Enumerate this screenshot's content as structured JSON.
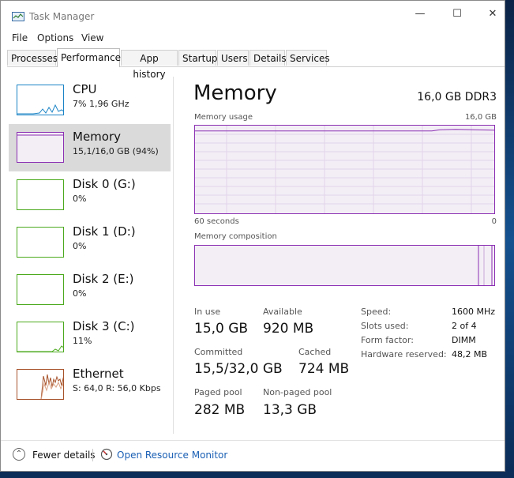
{
  "window": {
    "title": "Task Manager"
  },
  "controls": {
    "minimize": "—",
    "maximize": "☐",
    "close": "✕"
  },
  "menu": [
    "File",
    "Options",
    "View"
  ],
  "tabs": [
    "Processes",
    "Performance",
    "App history",
    "Startup",
    "Users",
    "Details",
    "Services"
  ],
  "active_tab": "Performance",
  "resources": [
    {
      "name": "CPU",
      "sub": "7% 1,96 GHz",
      "color": "#1b84c6"
    },
    {
      "name": "Memory",
      "sub": "15,1/16,0 GB (94%)",
      "color": "#8b2fb3"
    },
    {
      "name": "Disk 0 (G:)",
      "sub": "0%",
      "color": "#4caa1e"
    },
    {
      "name": "Disk 1 (D:)",
      "sub": "0%",
      "color": "#4caa1e"
    },
    {
      "name": "Disk 2 (E:)",
      "sub": "0%",
      "color": "#4caa1e"
    },
    {
      "name": "Disk 3 (C:)",
      "sub": "11%",
      "color": "#4caa1e"
    },
    {
      "name": "Ethernet",
      "sub": "S: 64,0  R: 56,0 Kbps",
      "color": "#a7532b"
    }
  ],
  "detail": {
    "title": "Memory",
    "spec": "16,0 GB DDR3",
    "usage_label": "Memory usage",
    "usage_max": "16,0 GB",
    "time_span": "60 seconds",
    "time_zero": "0",
    "composition_label": "Memory composition",
    "in_use_label": "In use",
    "in_use": "15,0 GB",
    "available_label": "Available",
    "available": "920 MB",
    "committed_label": "Committed",
    "committed": "15,5/32,0 GB",
    "cached_label": "Cached",
    "cached": "724 MB",
    "paged_label": "Paged pool",
    "paged": "282 MB",
    "nonpaged_label": "Non-paged pool",
    "nonpaged": "13,3 GB",
    "speed_label": "Speed:",
    "speed": "1600 MHz",
    "slots_label": "Slots used:",
    "slots": "2 of 4",
    "form_label": "Form factor:",
    "form": "DIMM",
    "hwres_label": "Hardware reserved:",
    "hwres": "48,2 MB"
  },
  "footer": {
    "fewer": "Fewer details",
    "monitor": "Open Resource Monitor"
  },
  "usage_fraction": 0.94
}
